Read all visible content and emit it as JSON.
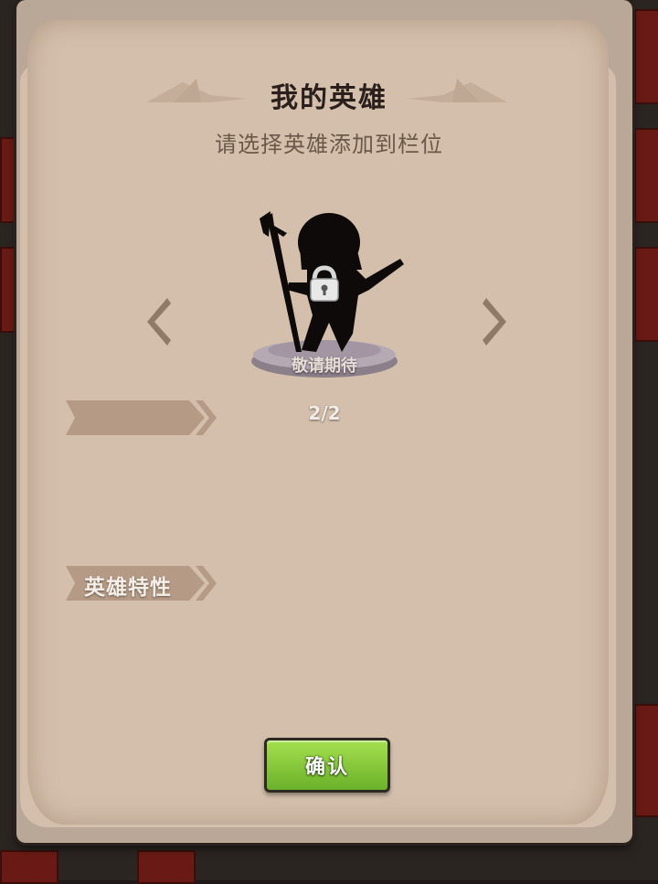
{
  "dialog": {
    "title": "我的英雄",
    "subtitle": "请选择英雄添加到栏位"
  },
  "hero": {
    "status_label": "敬请期待",
    "locked": true,
    "page_indicator": "2/2"
  },
  "sections": {
    "name_ribbon_label": "",
    "traits_ribbon_label": "英雄特性"
  },
  "buttons": {
    "confirm_label": "确认"
  },
  "colors": {
    "parchment": "#d3bfac",
    "panel_border": "#b9a898",
    "ribbon": "#b59b86",
    "confirm_green": "#8fcf3f",
    "title_text": "#2a1f1a"
  }
}
